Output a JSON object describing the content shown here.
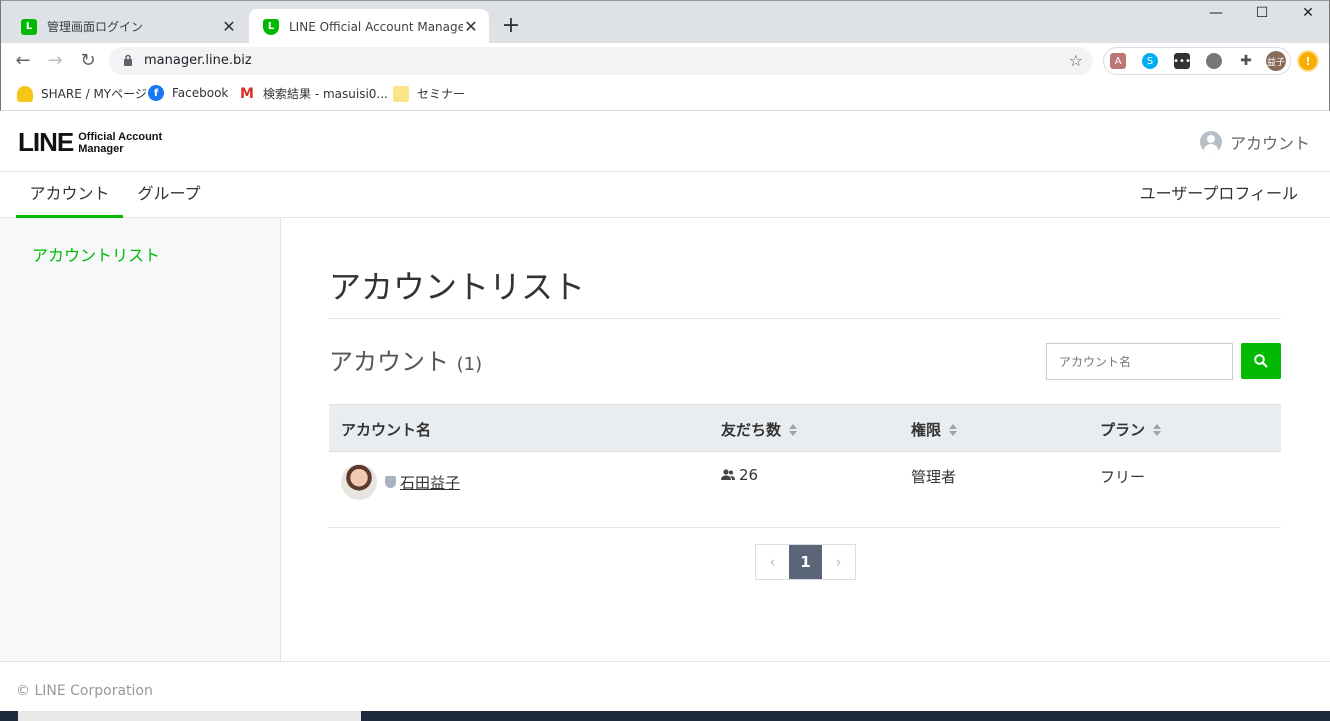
{
  "browser": {
    "tabs": [
      {
        "title": "管理画面ログイン",
        "favicon": "line-icon"
      },
      {
        "title": "LINE Official Account Manager",
        "favicon": "line-shield-icon"
      }
    ],
    "url": "manager.line.biz",
    "bookmarks": [
      "SHARE / MYページ",
      "Facebook",
      "検索結果 - masuisi0...",
      "セミナー"
    ],
    "profile_initials": "益子",
    "skype_letter": "S",
    "alert_symbol": "!"
  },
  "header": {
    "logo_big": "LINE",
    "logo_line1": "Official Account",
    "logo_line2": "Manager",
    "account_label": "アカウント"
  },
  "nav": {
    "tabs": [
      "アカウント",
      "グループ"
    ],
    "user_profile": "ユーザープロフィール"
  },
  "sidebar": {
    "item": "アカウントリスト"
  },
  "main": {
    "title": "アカウントリスト",
    "section_title": "アカウント",
    "section_count": "(1)",
    "search_placeholder": "アカウント名",
    "columns": [
      "アカウント名",
      "友だち数",
      "権限",
      "プラン"
    ],
    "rows": [
      {
        "name": "石田益子",
        "friends": "26",
        "role": "管理者",
        "plan": "フリー"
      }
    ],
    "pagination": {
      "current": "1"
    }
  },
  "footer": {
    "copyright": "© LINE Corporation"
  },
  "colors": {
    "brand_green": "#00b900",
    "pager_active": "#5b6578"
  }
}
